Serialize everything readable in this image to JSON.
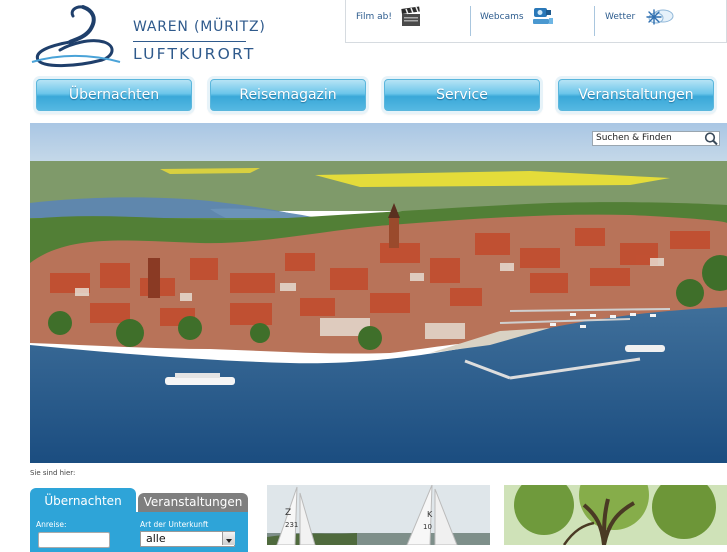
{
  "logo": {
    "line1": "WAREN (MÜRITZ)",
    "line2": "LUFTKURORT",
    "color": "#2f5a8c"
  },
  "utility": {
    "items": [
      {
        "label": "Film ab!",
        "icon": "clapperboard-icon"
      },
      {
        "label": "Webcams",
        "icon": "webcam-icon"
      },
      {
        "label": "Wetter",
        "icon": "weather-icon"
      }
    ]
  },
  "nav": {
    "items": [
      {
        "label": "Übernachten"
      },
      {
        "label": "Reisemagazin"
      },
      {
        "label": "Service"
      },
      {
        "label": "Veranstaltungen"
      }
    ],
    "color": "#3aa8d8"
  },
  "search": {
    "placeholder": "Suchen & Finden",
    "icon": "magnifier-icon"
  },
  "hero": {
    "image": "aerial-photo-of-town-and-lake"
  },
  "breadcrumb": {
    "label": "Sie sind hier:"
  },
  "booking": {
    "tab_active": "Übernachten",
    "tab_inactive": "Veranstaltungen",
    "arrival_label": "Anreise:",
    "type_label": "Art der Unterkunft",
    "type_value": "alle",
    "accent": "#2ea4d8"
  },
  "teasers": [
    {
      "image": "sailing-boats-photo"
    },
    {
      "image": "tree-photo"
    }
  ]
}
